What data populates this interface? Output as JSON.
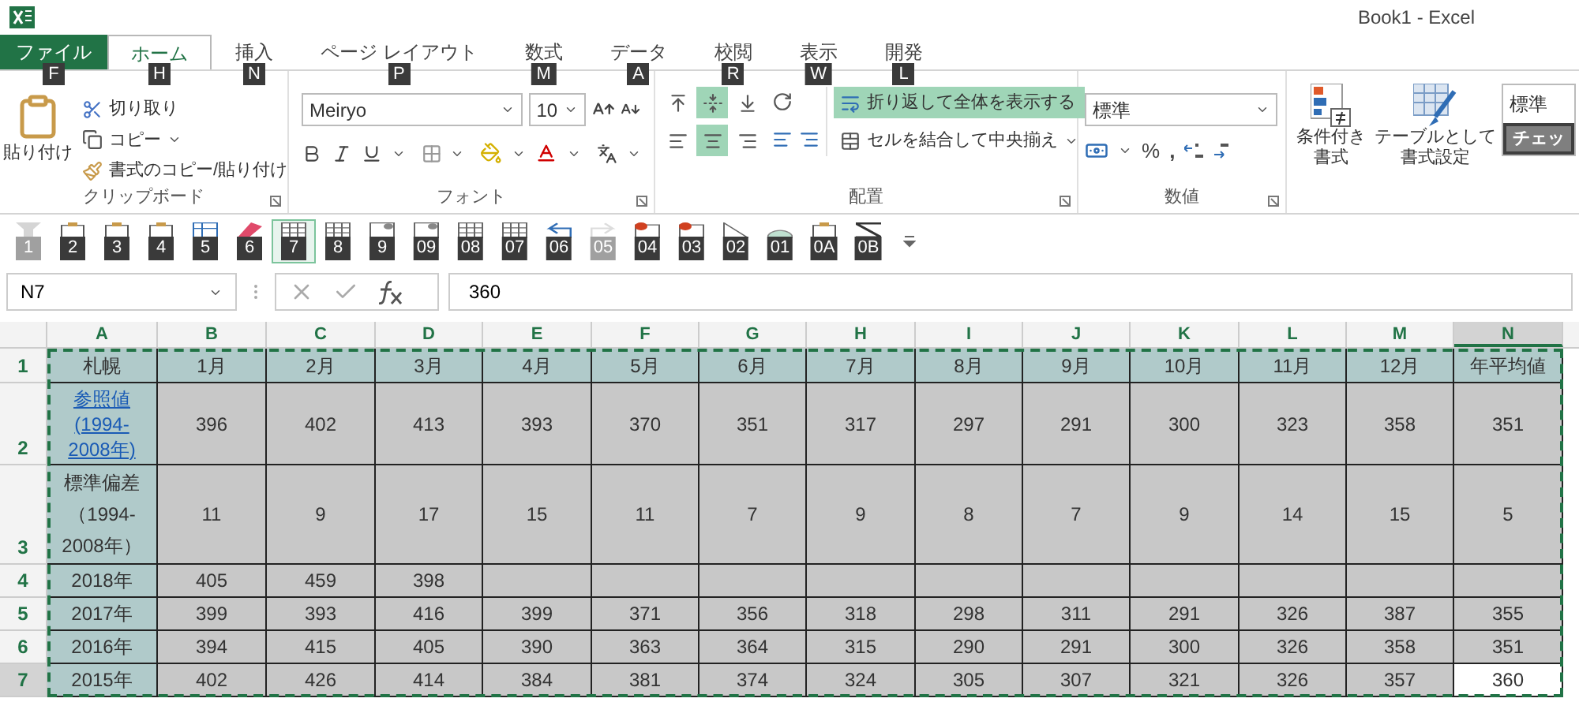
{
  "window": {
    "title": "Book1 - Excel"
  },
  "tabs": [
    {
      "label": "ファイル",
      "keytip": "F",
      "kind": "file",
      "selected": false
    },
    {
      "label": "ホーム",
      "keytip": "H",
      "kind": "tab",
      "selected": true
    },
    {
      "label": "挿入",
      "keytip": "N",
      "kind": "tab",
      "selected": false
    },
    {
      "label": "ページ レイアウト",
      "keytip": "P",
      "kind": "tab",
      "selected": false
    },
    {
      "label": "数式",
      "keytip": "M",
      "kind": "tab",
      "selected": false
    },
    {
      "label": "データ",
      "keytip": "A",
      "kind": "tab",
      "selected": false
    },
    {
      "label": "校閲",
      "keytip": "R",
      "kind": "tab",
      "selected": false
    },
    {
      "label": "表示",
      "keytip": "W",
      "kind": "tab",
      "selected": false
    },
    {
      "label": "開発",
      "keytip": "L",
      "kind": "tab",
      "selected": false
    }
  ],
  "ribbon": {
    "clipboard": {
      "label": "クリップボード",
      "paste": "貼り付け",
      "cut": "切り取り",
      "copy": "コピー",
      "format_painter": "書式のコピー/貼り付け"
    },
    "font": {
      "label": "フォント",
      "font_name": "Meiryo",
      "font_size": "10"
    },
    "alignment": {
      "label": "配置",
      "vertical": [
        {
          "selected": false
        },
        {
          "selected": true
        },
        {
          "selected": false
        }
      ],
      "horizontal": [
        {
          "selected": false
        },
        {
          "selected": true
        },
        {
          "selected": false
        }
      ],
      "wrap_text": {
        "label": "折り返して全体を表示する",
        "selected": true
      },
      "merge": "セルを結合して中央揃え"
    },
    "number": {
      "label": "数値",
      "format": "標準",
      "percent": "%",
      "comma": ","
    },
    "styles": {
      "conditional": "条件付き書式",
      "table_format": "テーブルとして書式設定",
      "cell_styles": [
        {
          "label": "標準",
          "kind": "normal"
        },
        {
          "label": "チェッ",
          "kind": "check"
        }
      ]
    }
  },
  "quick_access": [
    {
      "keytip": "1",
      "disabled": true,
      "selected": false
    },
    {
      "keytip": "2",
      "disabled": false,
      "selected": false
    },
    {
      "keytip": "3",
      "disabled": false,
      "selected": false
    },
    {
      "keytip": "4",
      "disabled": false,
      "selected": false
    },
    {
      "keytip": "5",
      "disabled": false,
      "selected": false
    },
    {
      "keytip": "6",
      "disabled": false,
      "selected": false
    },
    {
      "keytip": "7",
      "disabled": false,
      "selected": true
    },
    {
      "keytip": "8",
      "disabled": false,
      "selected": false
    },
    {
      "keytip": "9",
      "disabled": false,
      "selected": false
    },
    {
      "keytip": "09",
      "disabled": false,
      "selected": false
    },
    {
      "keytip": "08",
      "disabled": false,
      "selected": false
    },
    {
      "keytip": "07",
      "disabled": false,
      "selected": false
    },
    {
      "keytip": "06",
      "disabled": false,
      "selected": false
    },
    {
      "keytip": "05",
      "disabled": true,
      "selected": false
    },
    {
      "keytip": "04",
      "disabled": false,
      "selected": false
    },
    {
      "keytip": "03",
      "disabled": false,
      "selected": false
    },
    {
      "keytip": "02",
      "disabled": false,
      "selected": false
    },
    {
      "keytip": "01",
      "disabled": false,
      "selected": false
    },
    {
      "keytip": "0A",
      "disabled": false,
      "selected": false
    },
    {
      "keytip": "0B",
      "disabled": false,
      "selected": false
    }
  ],
  "formula_bar": {
    "name_box": "N7",
    "value": "360"
  },
  "sheet": {
    "columns": [
      {
        "label": "A",
        "selected": false
      },
      {
        "label": "B",
        "selected": false
      },
      {
        "label": "C",
        "selected": false
      },
      {
        "label": "D",
        "selected": false
      },
      {
        "label": "E",
        "selected": false
      },
      {
        "label": "F",
        "selected": false
      },
      {
        "label": "G",
        "selected": false
      },
      {
        "label": "H",
        "selected": false
      },
      {
        "label": "I",
        "selected": false
      },
      {
        "label": "J",
        "selected": false
      },
      {
        "label": "K",
        "selected": false
      },
      {
        "label": "L",
        "selected": false
      },
      {
        "label": "M",
        "selected": false
      },
      {
        "label": "N",
        "selected": true
      }
    ],
    "rows": [
      {
        "header": "1",
        "kind": "header",
        "selected": false,
        "cells": [
          "札幌",
          "1月",
          "2月",
          "3月",
          "4月",
          "5月",
          "6月",
          "7月",
          "8月",
          "9月",
          "10月",
          "11月",
          "12月",
          "年平均値"
        ]
      },
      {
        "header": "2",
        "kind": "tall",
        "selected": false,
        "link": true,
        "cells": [
          "参照値(1994-2008年)",
          "396",
          "402",
          "413",
          "393",
          "370",
          "351",
          "317",
          "297",
          "291",
          "300",
          "323",
          "358",
          "351"
        ]
      },
      {
        "header": "3",
        "kind": "taller",
        "selected": false,
        "link": false,
        "cells": [
          "標準偏差（1994-2008年）",
          "11",
          "9",
          "17",
          "15",
          "11",
          "7",
          "9",
          "8",
          "7",
          "9",
          "14",
          "15",
          "5"
        ]
      },
      {
        "header": "4",
        "kind": "data",
        "selected": false,
        "link": false,
        "cells": [
          "2018年",
          "405",
          "459",
          "398"
        ]
      },
      {
        "header": "5",
        "kind": "data",
        "selected": false,
        "link": false,
        "cells": [
          "2017年",
          "399",
          "393",
          "416",
          "399",
          "371",
          "356",
          "318",
          "298",
          "311",
          "291",
          "326",
          "387",
          "355"
        ]
      },
      {
        "header": "6",
        "kind": "data",
        "selected": false,
        "link": false,
        "cells": [
          "2016年",
          "394",
          "415",
          "405",
          "390",
          "363",
          "364",
          "315",
          "290",
          "291",
          "300",
          "326",
          "358",
          "351"
        ]
      },
      {
        "header": "7",
        "kind": "data",
        "selected": true,
        "link": false,
        "cells": [
          "2015年",
          "402",
          "426",
          "414",
          "384",
          "381",
          "374",
          "324",
          "305",
          "307",
          "321",
          "326",
          "357",
          "360"
        ]
      }
    ]
  }
}
